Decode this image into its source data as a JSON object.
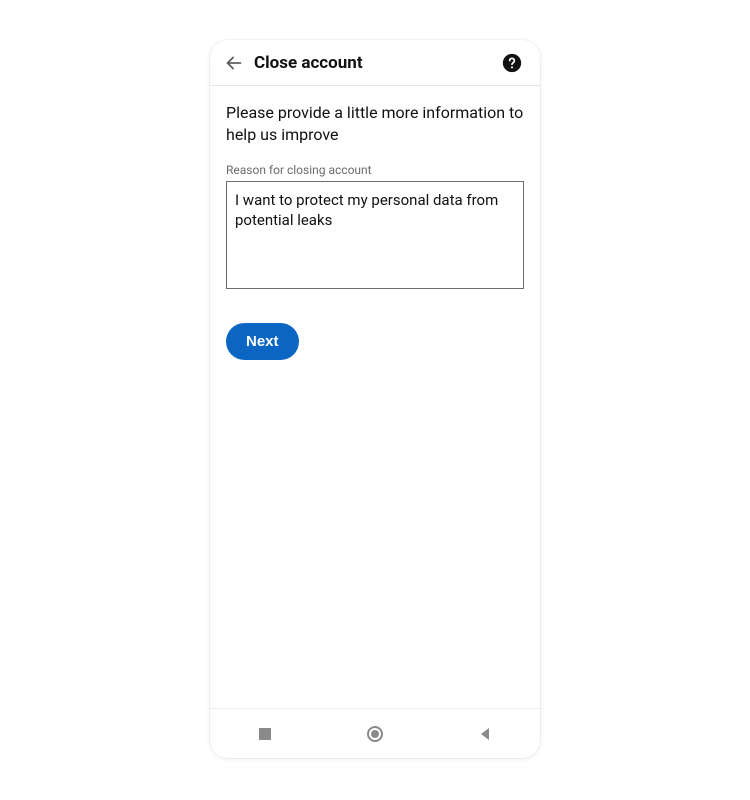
{
  "header": {
    "title": "Close account"
  },
  "main": {
    "prompt": "Please provide a little more information to help us improve",
    "reason_label": "Reason for closing account",
    "reason_value": "I want to protect my personal data from potential leaks",
    "next_label": "Next"
  },
  "colors": {
    "primary": "#0a66c2"
  }
}
